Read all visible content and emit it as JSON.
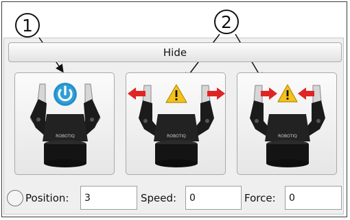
{
  "callouts": {
    "one": "1",
    "two": "2"
  },
  "hide_button": {
    "label": "Hide"
  },
  "grip_buttons": [
    {
      "action": "activate",
      "icon": "power-icon",
      "accent": "#2f9ed6"
    },
    {
      "action": "open",
      "icon": "warning-icon",
      "arrows": "outward",
      "accent": "#e02424"
    },
    {
      "action": "close",
      "icon": "warning-icon",
      "arrows": "inward",
      "accent": "#e02424"
    }
  ],
  "gripper_brand": "ROBOTIQ",
  "fields": {
    "position": {
      "label": "Position:",
      "value": "3"
    },
    "speed": {
      "label": "Speed:",
      "value": "0"
    },
    "force": {
      "label": "Force:",
      "value": "0"
    }
  },
  "colors": {
    "power_blue": "#2f9ed6",
    "warning_yellow": "#f4c21b",
    "arrow_red": "#e02424",
    "gripper_black": "#1b1b1b"
  }
}
